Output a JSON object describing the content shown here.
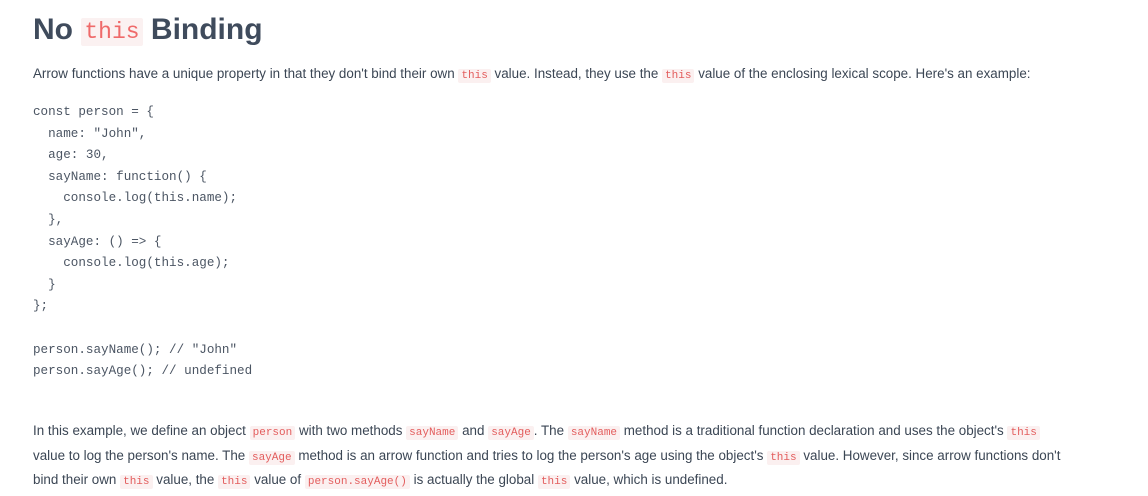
{
  "heading": {
    "prefix": "No",
    "code": "this",
    "suffix": "Binding"
  },
  "intro": {
    "t1": "Arrow functions have a unique property in that they don't bind their own",
    "c1": "this",
    "t2": "value. Instead, they use the",
    "c2": "this",
    "t3": "value of the enclosing lexical scope. Here's an example:"
  },
  "code_lines": [
    "const person = {",
    "  name: \"John\",",
    "  age: 30,",
    "  sayName: function() {",
    "    console.log(this.name);",
    "  },",
    "  sayAge: () => {",
    "    console.log(this.age);",
    "  }",
    "};",
    "",
    "person.sayName(); // \"John\"",
    "person.sayAge(); // undefined"
  ],
  "explain": {
    "l1": {
      "t1": "In this example, we define an object",
      "c1": "person",
      "t2": "with two methods",
      "c2": "sayName",
      "t3": "and",
      "c3": "sayAge",
      "t4": ". The",
      "c4": "sayName",
      "t5": "method is a traditional function declaration and uses the object's",
      "c5": "this"
    },
    "l2": {
      "t1": "value to log the person's name. The",
      "c1": "sayAge",
      "t2": "method is an arrow function and tries to log the person's age using the object's",
      "c2": "this",
      "t3": "value. However, since arrow functions don't"
    },
    "l3": {
      "t1": "bind their own",
      "c1": "this",
      "t2": "value, the",
      "c2": "this",
      "t3": "value of",
      "c3": "person.sayAge()",
      "t4": "is actually the global",
      "c4": "this",
      "t5": "value, which is undefined."
    }
  }
}
